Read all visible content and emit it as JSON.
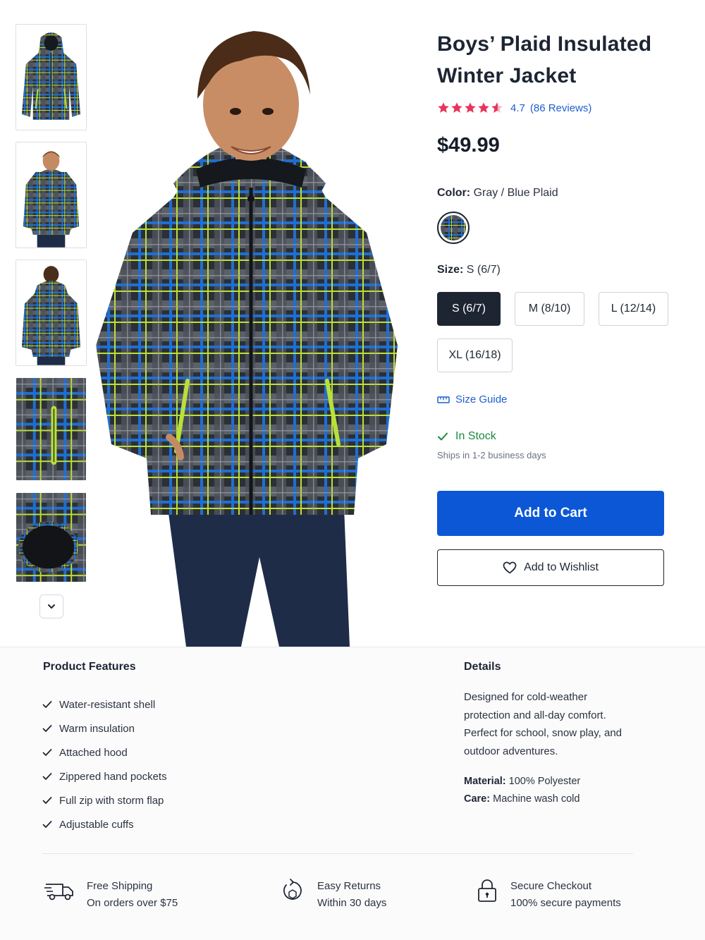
{
  "product": {
    "title_line1": "Boys’ Plaid Insulated",
    "title_line2": "Winter Jacket",
    "rating_value": 4.7,
    "rating_text": "4.7",
    "reviews_text": "(86 Reviews)",
    "price": "$49.99"
  },
  "color": {
    "label": "Color:",
    "value": "Gray / Blue Plaid"
  },
  "size": {
    "label": "Size:",
    "value": "S (6/7)",
    "options": [
      "S (6/7)",
      "M (8/10)",
      "L (12/14)",
      "XL (16/18)"
    ],
    "selected_index": 0
  },
  "size_guide_label": "Size Guide",
  "stock": {
    "status": "In Stock",
    "shipping": "Ships in 1-2 business days"
  },
  "actions": {
    "add_to_cart": "Add to Cart",
    "add_to_wishlist": "Add to Wishlist"
  },
  "features": {
    "title": "Product Features",
    "items": [
      "Water-resistant shell",
      "Warm insulation",
      "Attached hood",
      "Zippered hand pockets",
      "Full zip with storm flap",
      "Adjustable cuffs"
    ]
  },
  "details": {
    "title": "Details",
    "description": "Designed for cold-weather protection and all-day comfort. Perfect for school, snow play, and outdoor adventures.",
    "material_label": "Material:",
    "material_value": "100% Polyester",
    "care_label": "Care:",
    "care_value": "Machine wash cold"
  },
  "perks": [
    {
      "icon": "truck-icon",
      "title": "Free Shipping",
      "subtitle": "On orders over $75"
    },
    {
      "icon": "returns-icon",
      "title": "Easy Returns",
      "subtitle": "Within 30 days"
    },
    {
      "icon": "lock-icon",
      "title": "Secure Checkout",
      "subtitle": "100% secure payments"
    }
  ],
  "colors": {
    "accent_blue": "#0b57d6",
    "link_blue": "#1f5fcf",
    "star_pink": "#e8345a",
    "stock_green": "#1a8a3e",
    "dark": "#1e2532"
  }
}
